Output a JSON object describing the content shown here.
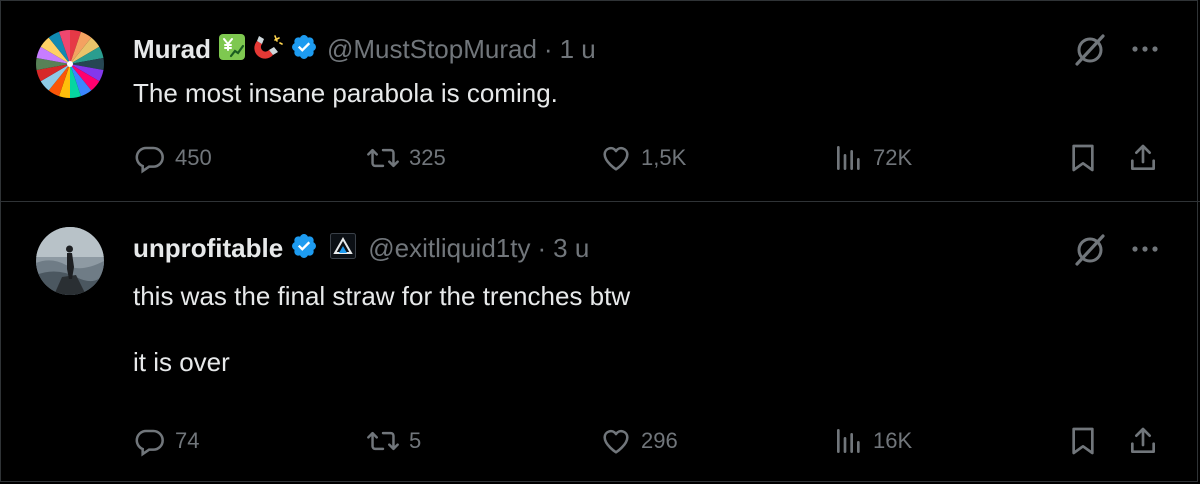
{
  "tweets": [
    {
      "name": "Murad",
      "name_emojis": [
        "yen-chart-emoji",
        "magnet-emoji"
      ],
      "verified": true,
      "handle": "@MustStopMurad",
      "separator": "·",
      "time": "1 u",
      "text": "The most insane parabola is coming.",
      "replies": "450",
      "reposts": "325",
      "likes": "1,5K",
      "views": "72K"
    },
    {
      "name": "unprofitable",
      "verified": true,
      "affiliate_badge": "triangle-logo-badge",
      "handle": "@exitliquid1ty",
      "separator": "·",
      "time": "3 u",
      "text": "this was the final straw for the trenches btw\n\nit is over",
      "replies": "74",
      "reposts": "5",
      "likes": "296",
      "views": "16K"
    }
  ],
  "colors": {
    "background": "#000000",
    "text": "#e7e9ea",
    "muted": "#71767b",
    "verified": "#1d9bf0",
    "divider": "#2f3336"
  }
}
